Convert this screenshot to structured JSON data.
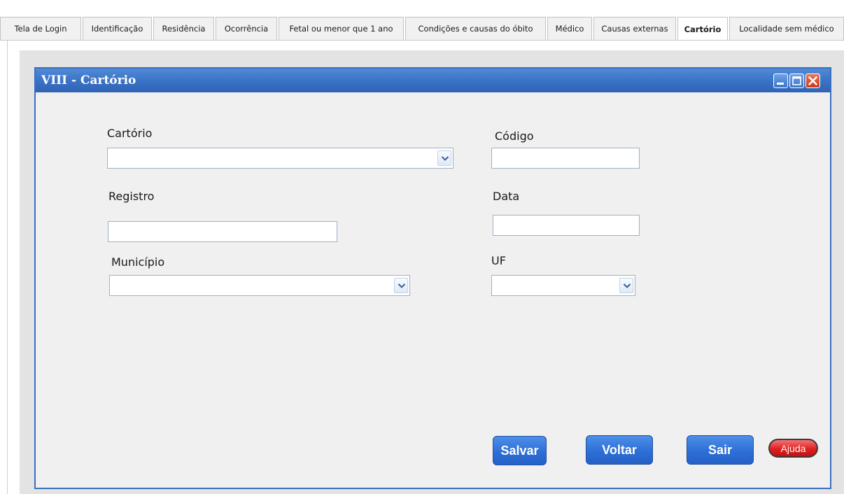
{
  "tabs": [
    {
      "label": "Tela de Login",
      "active": false
    },
    {
      "label": "Identificação",
      "active": false
    },
    {
      "label": "Residência",
      "active": false
    },
    {
      "label": "Ocorrência",
      "active": false
    },
    {
      "label": "Fetal ou menor que 1 ano",
      "active": false
    },
    {
      "label": "Condições e causas do óbito",
      "active": false
    },
    {
      "label": "Médico",
      "active": false
    },
    {
      "label": "Causas externas",
      "active": false
    },
    {
      "label": "Cartório",
      "active": true
    },
    {
      "label": "Localidade sem médico",
      "active": false
    }
  ],
  "window": {
    "title": "VIII - Cartório",
    "controls": {
      "minimize_icon": "minimize-icon",
      "maximize_icon": "maximize-icon",
      "close_icon": "close-icon"
    },
    "accent_color": "#3a72c6"
  },
  "form": {
    "cartorio": {
      "label": "Cartório",
      "value": ""
    },
    "codigo": {
      "label": "Código",
      "value": ""
    },
    "registro": {
      "label": "Registro",
      "value": ""
    },
    "data": {
      "label": "Data",
      "value": ""
    },
    "municipio": {
      "label": "Município",
      "value": ""
    },
    "uf": {
      "label": "UF",
      "value": ""
    }
  },
  "buttons": {
    "salvar": "Salvar",
    "voltar": "Voltar",
    "sair": "Sair",
    "ajuda": "Ajuda"
  },
  "colors": {
    "primary_button": "#2d6fd6",
    "help_button": "#e01f1f"
  }
}
